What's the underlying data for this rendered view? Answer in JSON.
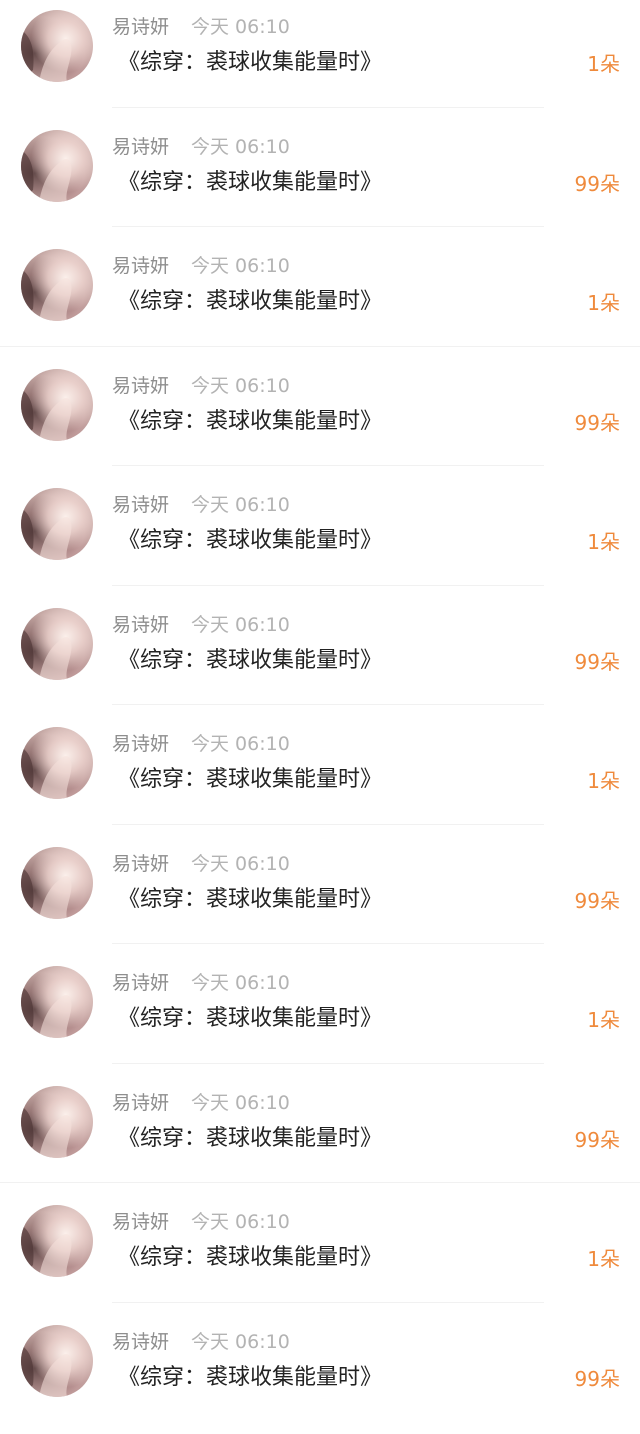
{
  "items": [
    {
      "name": "易诗妍",
      "time": "今天 06:10",
      "title": "《综穿：裘球收集能量时》",
      "amount": "1朵"
    },
    {
      "name": "易诗妍",
      "time": "今天 06:10",
      "title": "《综穿：裘球收集能量时》",
      "amount": "99朵"
    },
    {
      "name": "易诗妍",
      "time": "今天 06:10",
      "title": "《综穿：裘球收集能量时》",
      "amount": "1朵"
    },
    {
      "name": "易诗妍",
      "time": "今天 06:10",
      "title": "《综穿：裘球收集能量时》",
      "amount": "99朵"
    },
    {
      "name": "易诗妍",
      "time": "今天 06:10",
      "title": "《综穿：裘球收集能量时》",
      "amount": "1朵"
    },
    {
      "name": "易诗妍",
      "time": "今天 06:10",
      "title": "《综穿：裘球收集能量时》",
      "amount": "99朵"
    },
    {
      "name": "易诗妍",
      "time": "今天 06:10",
      "title": "《综穿：裘球收集能量时》",
      "amount": "1朵"
    },
    {
      "name": "易诗妍",
      "time": "今天 06:10",
      "title": "《综穿：裘球收集能量时》",
      "amount": "99朵"
    },
    {
      "name": "易诗妍",
      "time": "今天 06:10",
      "title": "《综穿：裘球收集能量时》",
      "amount": "1朵"
    },
    {
      "name": "易诗妍",
      "time": "今天 06:10",
      "title": "《综穿：裘球收集能量时》",
      "amount": "99朵"
    },
    {
      "name": "易诗妍",
      "time": "今天 06:10",
      "title": "《综穿：裘球收集能量时》",
      "amount": "1朵"
    },
    {
      "name": "易诗妍",
      "time": "今天 06:10",
      "title": "《综穿：裘球收集能量时》",
      "amount": "99朵"
    }
  ],
  "colors": {
    "amount": "#ef8a3c",
    "name": "#8e8e8e",
    "time": "#b3b3b3",
    "title": "#222222"
  },
  "icons": {
    "avatar": "user-avatar-photo"
  }
}
